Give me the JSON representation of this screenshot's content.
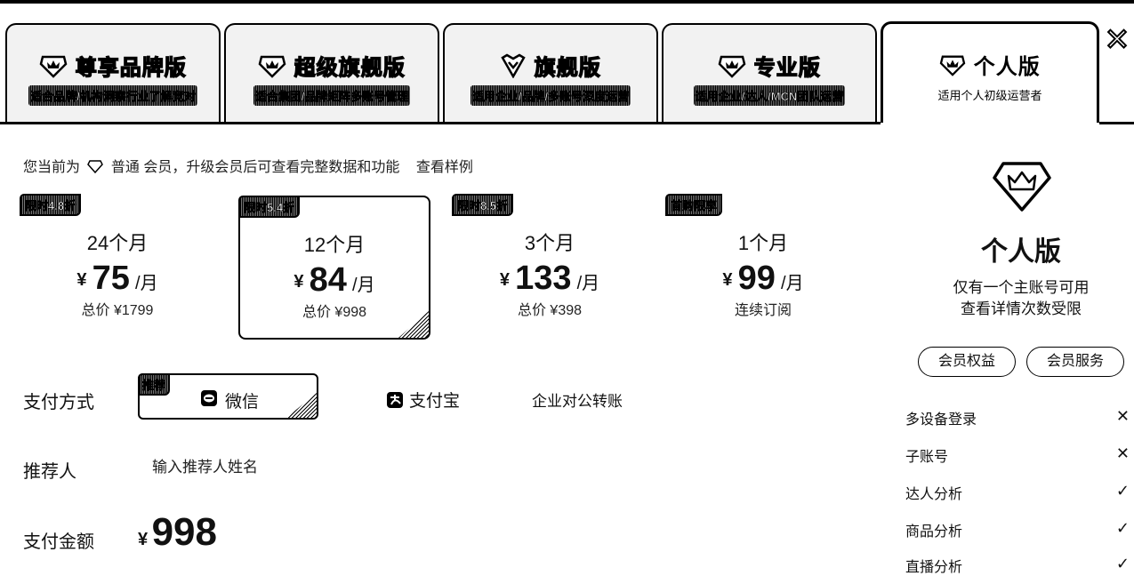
{
  "tabs": [
    {
      "title": "尊享品牌版",
      "subtitle": "适合品牌/机构洞察行业了解竞对",
      "icon": "crown-gem-icon"
    },
    {
      "title": "超级旗舰版",
      "subtitle": "适合集团/品牌矩阵多账号管理",
      "icon": "crown-gem-icon"
    },
    {
      "title": "旗舰版",
      "subtitle": "适用企业/品牌/多账号深度运营",
      "icon": "crown-gem-icon"
    },
    {
      "title": "专业版",
      "subtitle": "适用企业/达人/MCN团队运营",
      "icon": "crown-gem-icon"
    },
    {
      "title": "个人版",
      "subtitle": "适用个人初级运营者",
      "icon": "crown-gem-icon"
    }
  ],
  "close_label": "✕",
  "status": {
    "prefix": "您当前为",
    "level": "普通 会员，升级会员后可查看完整数据和功能",
    "sample_link": "查看样例"
  },
  "plans": [
    {
      "badge": "限时4.8折",
      "duration": "24个月",
      "yen": "¥",
      "price": "75",
      "unit": "/月",
      "total": "总价 ¥1799"
    },
    {
      "badge": "限时5.4折",
      "duration": "12个月",
      "yen": "¥",
      "price": "84",
      "unit": "/月",
      "total": "总价 ¥998"
    },
    {
      "badge": "限时8.5折",
      "duration": "3个月",
      "yen": "¥",
      "price": "133",
      "unit": "/月",
      "total": "总价 ¥398"
    },
    {
      "badge": "首购限享",
      "duration": "1个月",
      "yen": "¥",
      "price": "99",
      "unit": "/月",
      "total": "连续订阅"
    }
  ],
  "payment": {
    "label": "支付方式",
    "recommend_badge": "推荐",
    "wechat": "微信",
    "alipay": "支付宝",
    "corporate": "企业对公转账"
  },
  "referrer": {
    "label": "推荐人",
    "placeholder": "输入推荐人姓名"
  },
  "amount": {
    "label": "支付金额",
    "yen": "¥",
    "value": "998"
  },
  "right_panel": {
    "title": "个人版",
    "desc_line1": "仅有一个主账号可用",
    "desc_line2": "查看详情次数受限",
    "btn_benefits": "会员权益",
    "btn_service": "会员服务",
    "features": [
      {
        "name": "多设备登录",
        "mark": "✕"
      },
      {
        "name": "子账号",
        "mark": "✕"
      },
      {
        "name": "达人分析",
        "mark": "✓"
      },
      {
        "name": "商品分析",
        "mark": "✓"
      },
      {
        "name": "直播分析",
        "mark": "✓"
      }
    ]
  }
}
